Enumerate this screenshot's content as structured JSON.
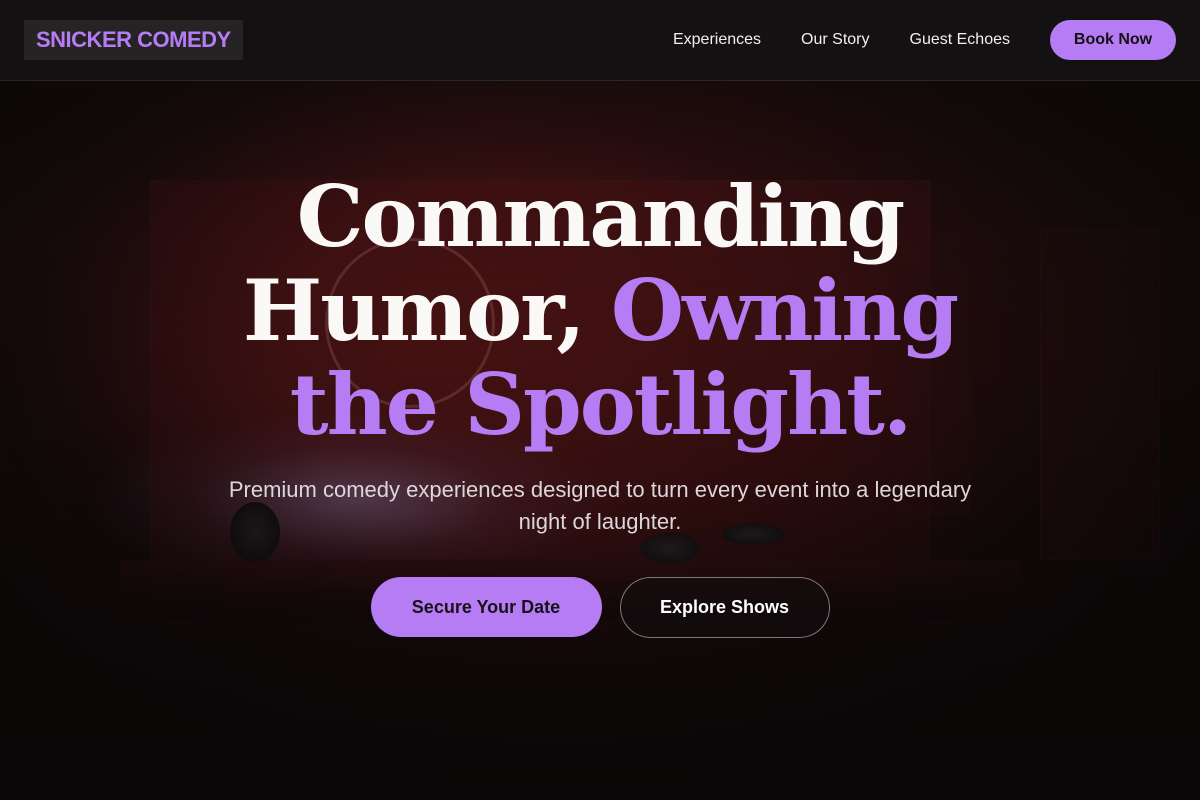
{
  "brand": {
    "logo_text": "SNICKER COMEDY",
    "accent_color": "#b57cf4"
  },
  "nav": {
    "links": [
      {
        "label": "Experiences"
      },
      {
        "label": "Our Story"
      },
      {
        "label": "Guest Echoes"
      }
    ],
    "cta_label": "Book Now"
  },
  "hero": {
    "title_line1": "Commanding",
    "title_line2_plain": "Humor,",
    "title_line2_accent": "Owning",
    "title_line3_accent": "the Spotlight.",
    "subtitle": "Premium comedy experiences designed to turn every event into a legendary night of laughter.",
    "primary_cta": "Secure Your Date",
    "secondary_cta": "Explore Shows"
  },
  "colors": {
    "background": "#0e0c0d",
    "nav_background": "#131112",
    "text": "#ffffff"
  }
}
